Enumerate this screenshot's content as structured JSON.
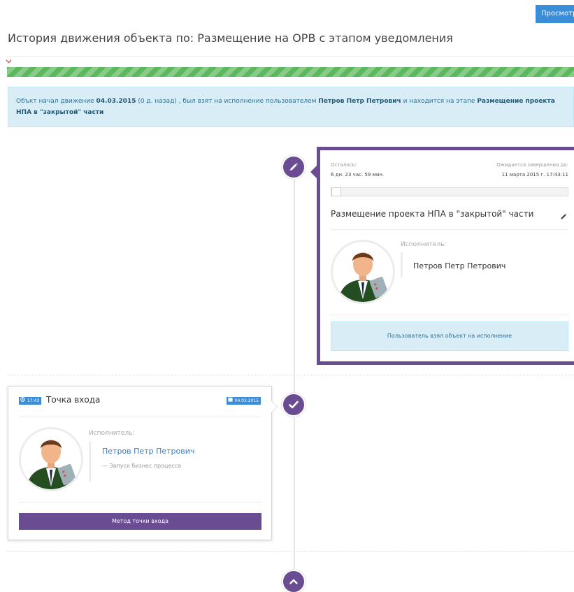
{
  "header": {
    "view_button": "Просмотр",
    "title": "История движения объекта по: Размещение на ОРВ с этапом уведомления"
  },
  "info": {
    "p1": "Объкт начал движение ",
    "start_date": "04.03.2015",
    "p2": " (0 д. назад) , был взят на исполнение пользователем ",
    "user": "Петров Петр Петрович",
    "p3": " и находится на этапе ",
    "stage": "Размещение проекта НПА в \"закрытой\" части"
  },
  "active_stage": {
    "remaining_label": "Осталось:",
    "remaining_value": "6 дн. 23 час. 59 мин.",
    "expected_label": "Ожидается завершения до:",
    "expected_value": "11 марта 2015 г. 17:43:11",
    "progress_fraction": 0.02,
    "title": "Размещение проекта НПА в \"закрытой\" части",
    "executor_label": "Исполнитель:",
    "executor_name": "Петров Петр Петрович",
    "status_message": "Пользователь взял объект на исполнение"
  },
  "entry_point": {
    "time": "17:43",
    "title": "Точка входа",
    "date": "04.03.2015",
    "executor_label": "Исполнитель:",
    "executor_name": "Петров Петр Петрович",
    "executor_note": "— Запуск бизнес процесса",
    "method_button": "Метод точки входа"
  },
  "icons": {
    "active_node": "pencil-icon",
    "done_node": "check-icon",
    "bottom_node": "chevron-up-icon"
  },
  "colors": {
    "accent_purple": "#6a4c93",
    "primary_blue": "#3a8dd6",
    "info_bg": "#d9edf7",
    "success_green": "#5cb85c"
  }
}
